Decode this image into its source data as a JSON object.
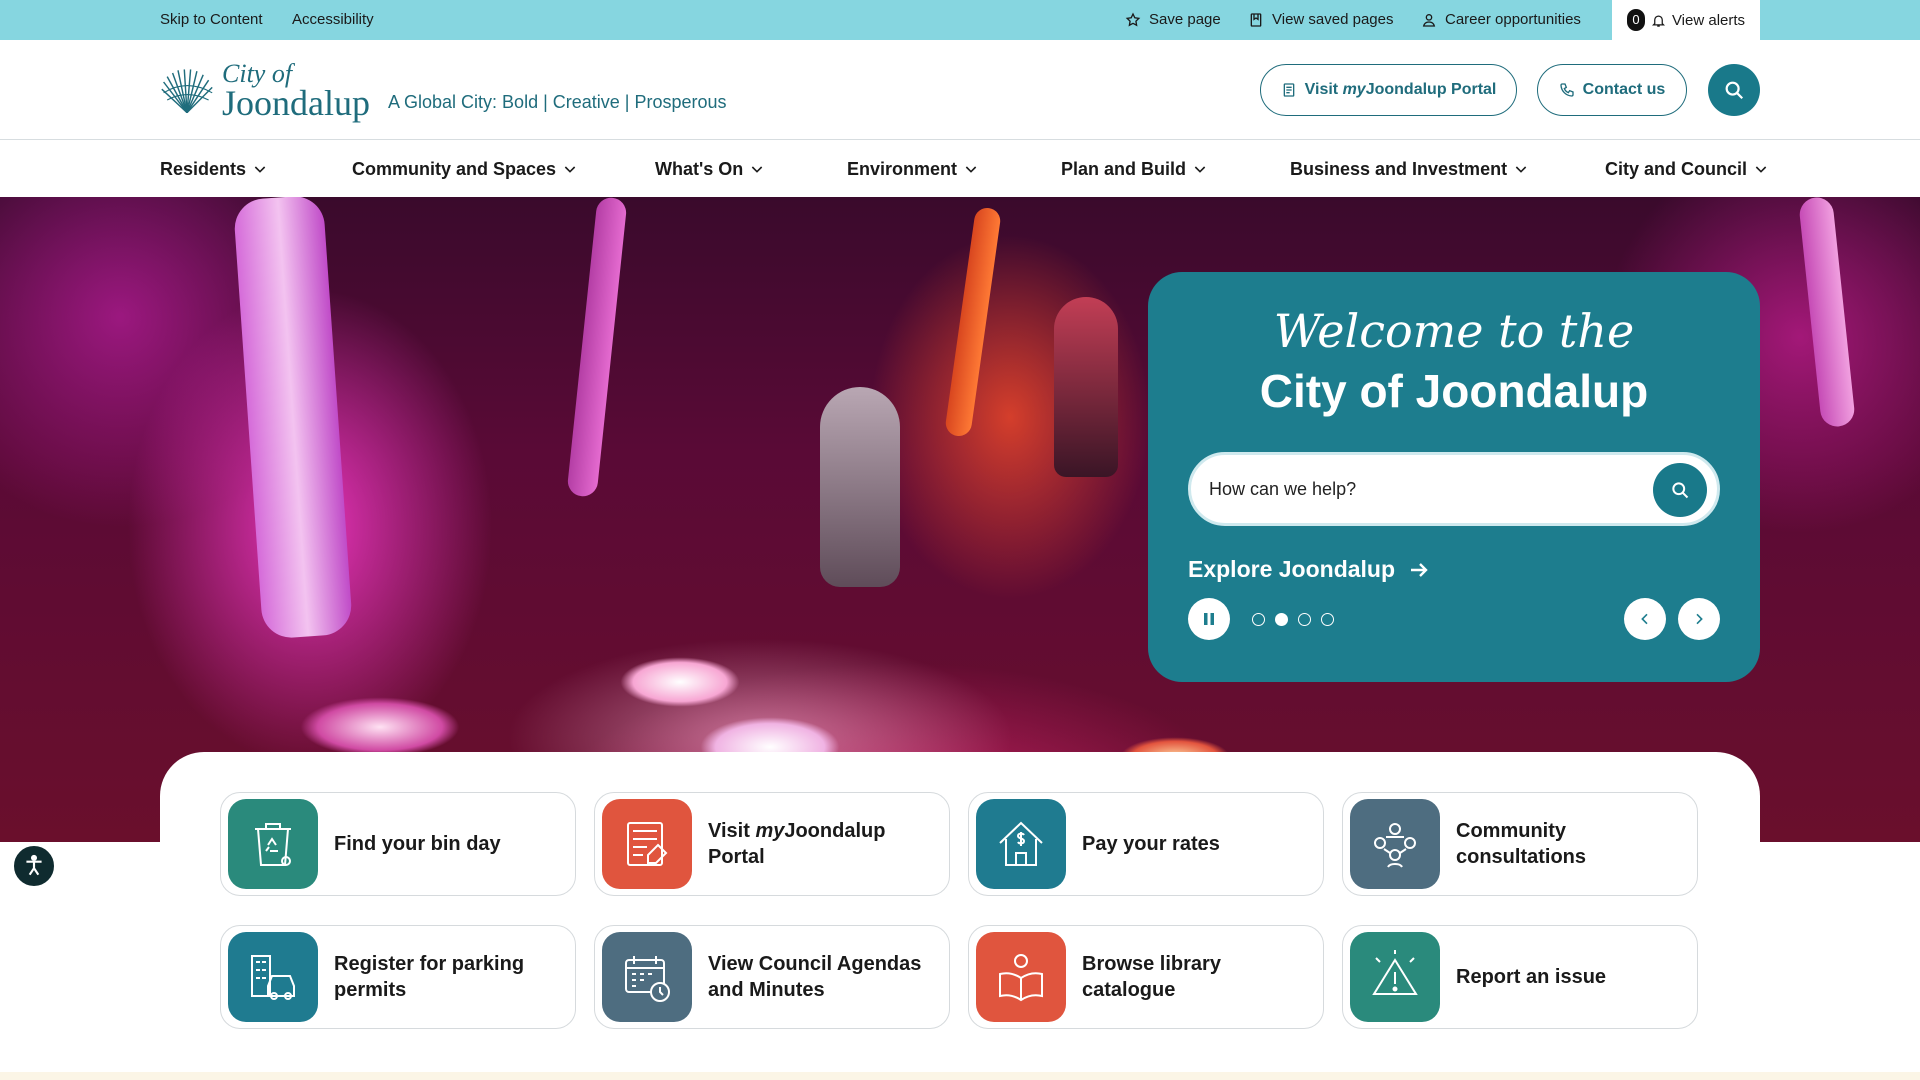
{
  "utility": {
    "skip_label": "Skip to Content",
    "accessibility_label": "Accessibility",
    "save_page_label": "Save page",
    "saved_pages_label": "View saved pages",
    "careers_label": "Career opportunities",
    "alerts_count": "0",
    "alerts_label": "View alerts"
  },
  "header": {
    "logo_line1": "City of",
    "logo_line2": "Joondalup",
    "tagline": "A Global City: Bold | Creative | Prosperous",
    "portal_prefix": "Visit ",
    "portal_brand": "my",
    "portal_suffix": "Joondalup Portal",
    "contact_label": "Contact us"
  },
  "nav": {
    "items": [
      {
        "label": "Residents"
      },
      {
        "label": "Community and Spaces"
      },
      {
        "label": "What's On"
      },
      {
        "label": "Environment"
      },
      {
        "label": "Plan and Build"
      },
      {
        "label": "Business and Investment"
      },
      {
        "label": "City and Council"
      }
    ]
  },
  "hero": {
    "welcome_script": "Welcome to the",
    "welcome_title": "City of Joondalup",
    "search_placeholder": "How can we help?",
    "explore_label": "Explore Joondalup",
    "slide_count": 4,
    "active_slide": 2
  },
  "quick_links": [
    {
      "label": "Find your bin day",
      "color": "#2a8a7c"
    },
    {
      "label_prefix": "Visit ",
      "label_brand": "my",
      "label_suffix": "Joondalup Portal",
      "color": "#e0553e"
    },
    {
      "label": "Pay your rates",
      "color": "#1f7b90"
    },
    {
      "label": "Community consultations",
      "color": "#4e6d80"
    },
    {
      "label": "Register for parking permits",
      "color": "#1f7b90"
    },
    {
      "label": "View Council Agendas and Minutes",
      "color": "#4e6d80"
    },
    {
      "label": "Browse library catalogue",
      "color": "#e0553e"
    },
    {
      "label": "Report an issue",
      "color": "#2a8a7c"
    }
  ],
  "colors": {
    "utility_bar": "#86d6e0",
    "brand_teal": "#1d7d8e",
    "brand_text": "#1f6c7c"
  }
}
